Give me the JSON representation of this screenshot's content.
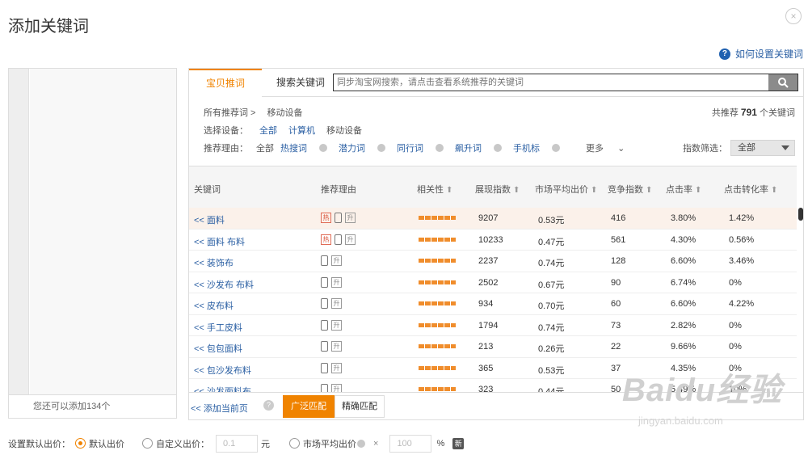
{
  "dialog": {
    "title": "添加关键词",
    "close": "×"
  },
  "help": {
    "icon": "question-icon",
    "label": "如何设置关键词"
  },
  "left": {
    "footer": "您还可以添加134个"
  },
  "tabs": {
    "active": "宝贝推词",
    "second": "搜索关键词"
  },
  "search": {
    "placeholder": "同步淘宝网搜索，请点击查看系统推荐的关键词",
    "icon": "search-icon"
  },
  "breadcrumb": {
    "root": "所有推荐词 >",
    "current": "移动设备"
  },
  "total": {
    "prefix": "共推荐",
    "count": "791",
    "suffix": "个关键词"
  },
  "device": {
    "label": "选择设备：",
    "options": [
      "全部",
      "计算机",
      "移动设备"
    ]
  },
  "reason": {
    "label": "推荐理由：",
    "options": [
      "全部",
      "热搜词",
      "潜力词",
      "同行词",
      "飙升词",
      "手机标"
    ],
    "more": "更多"
  },
  "index_filter": {
    "label": "指数筛选：",
    "value": "全部"
  },
  "columns": [
    "关键词",
    "推荐理由",
    "相关性",
    "展现指数",
    "市场平均出价",
    "竞争指数",
    "点击率",
    "点击转化率"
  ],
  "rows": [
    {
      "kw": "<< 面料",
      "hot": true,
      "show": "9207",
      "price": "0.53元",
      "comp": "416",
      "ctr": "3.80%",
      "cvr": "1.42%"
    },
    {
      "kw": "<< 面料 布料",
      "hot": true,
      "show": "10233",
      "price": "0.47元",
      "comp": "561",
      "ctr": "4.30%",
      "cvr": "0.56%"
    },
    {
      "kw": "<< 装饰布",
      "hot": false,
      "show": "2237",
      "price": "0.74元",
      "comp": "128",
      "ctr": "6.60%",
      "cvr": "3.46%"
    },
    {
      "kw": "<< 沙发布 布料",
      "hot": false,
      "show": "2502",
      "price": "0.67元",
      "comp": "90",
      "ctr": "6.74%",
      "cvr": "0%"
    },
    {
      "kw": "<< 皮布料",
      "hot": false,
      "show": "934",
      "price": "0.70元",
      "comp": "60",
      "ctr": "6.60%",
      "cvr": "4.22%"
    },
    {
      "kw": "<< 手工皮料",
      "hot": false,
      "show": "1794",
      "price": "0.74元",
      "comp": "73",
      "ctr": "2.82%",
      "cvr": "0%"
    },
    {
      "kw": "<< 包包面料",
      "hot": false,
      "show": "213",
      "price": "0.26元",
      "comp": "22",
      "ctr": "9.66%",
      "cvr": "0%"
    },
    {
      "kw": "<< 包沙发布料",
      "hot": false,
      "show": "365",
      "price": "0.53元",
      "comp": "37",
      "ctr": "4.35%",
      "cvr": "0%"
    },
    {
      "kw": "<< 沙发面料布",
      "hot": false,
      "show": "323",
      "price": "0.44元",
      "comp": "50",
      "ctr": "5.49%",
      "cvr": "10%"
    }
  ],
  "badges": {
    "hot": "热",
    "up": "升"
  },
  "bottom": {
    "add_page": "<< 添加当前页",
    "broad": "广泛匹配",
    "exact": "精确匹配"
  },
  "settings": {
    "label": "设置默认出价：",
    "default": "默认出价",
    "custom": "自定义出价：",
    "custom_value": "0.1",
    "unit": "元",
    "market": "市场平均出价",
    "times": "×",
    "pct_value": "100",
    "pct": "%",
    "new_badge": "新"
  },
  "watermark": {
    "brand": "Baidu经验",
    "url": "jingyan.baidu.com"
  },
  "colors": {
    "accent": "#f08300",
    "link": "#2a5fa3"
  }
}
